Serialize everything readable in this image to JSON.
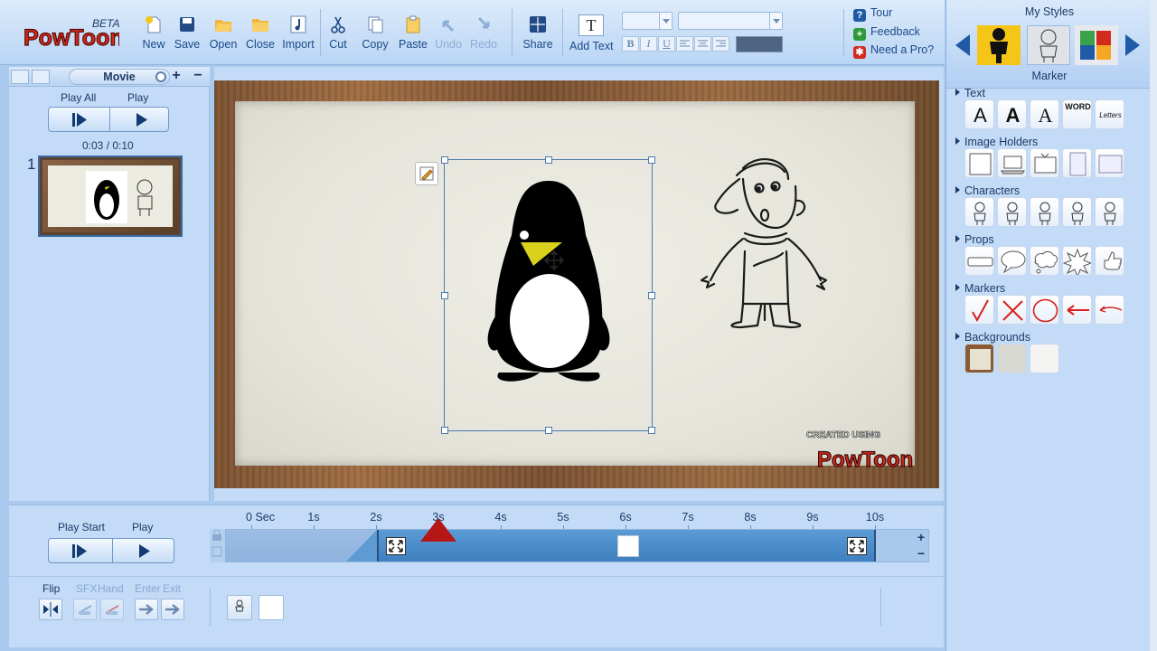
{
  "app": {
    "name": "PowToon",
    "badge": "BETA"
  },
  "toolbar": {
    "buttons": [
      {
        "label": "New",
        "icon": "new-file-icon"
      },
      {
        "label": "Save",
        "icon": "save-disk-icon"
      },
      {
        "label": "Open",
        "icon": "open-folder-icon"
      },
      {
        "label": "Close",
        "icon": "close-folder-icon"
      },
      {
        "label": "Import",
        "icon": "music-note-icon"
      },
      {
        "label": "Cut",
        "icon": "scissors-icon"
      },
      {
        "label": "Copy",
        "icon": "copy-icon"
      },
      {
        "label": "Paste",
        "icon": "paste-icon"
      },
      {
        "label": "Undo",
        "icon": "undo-arrow-icon",
        "disabled": true
      },
      {
        "label": "Redo",
        "icon": "redo-arrow-icon",
        "disabled": true
      },
      {
        "label": "Share",
        "icon": "share-grid-icon"
      },
      {
        "label": "Add Text",
        "icon": "text-T-icon"
      }
    ],
    "add_text_glyph": "T",
    "format": {
      "bold": "B",
      "italic": "I",
      "underline": "U"
    },
    "help": {
      "tour": "Tour",
      "feedback": "Feedback",
      "pro": "Need a Pro?",
      "tour_icon_text": "?",
      "feedback_icon_text": "+",
      "pro_icon_text": "✱"
    }
  },
  "left_panel": {
    "tab_label": "Movie",
    "add": "+",
    "remove": "−",
    "play_all_label": "Play All",
    "play_label": "Play",
    "time": "0:03 / 0:10",
    "slide_number": "1"
  },
  "stage": {
    "watermark_small": "CREATED USING",
    "watermark_big": "PowToon"
  },
  "right_panel": {
    "title": "My Styles",
    "selected_style": "Marker",
    "sections": {
      "text": "Text",
      "image_holders": "Image Holders",
      "characters": "Characters",
      "props": "Props",
      "markers": "Markers",
      "backgrounds": "Backgrounds"
    },
    "text_items": [
      "A",
      "A",
      "A",
      "WORD",
      "Letters"
    ]
  },
  "timeline": {
    "play_start_label": "Play Start",
    "play_label": "Play",
    "ticks": [
      "0 Sec",
      "1s",
      "2s",
      "3s",
      "4s",
      "5s",
      "6s",
      "7s",
      "8s",
      "9s",
      "10s"
    ],
    "playhead_seconds": 3,
    "object_start_seconds": 2,
    "object_end_seconds": 10,
    "zoom_in": "+",
    "zoom_out": "−",
    "flip_label": "Flip",
    "sfx_label": "SFX",
    "hand_label": "Hand",
    "enter_label": "Enter",
    "exit_label": "Exit"
  },
  "colors": {
    "accent": "#3e7fbf",
    "playhead": "#b51616",
    "selected_color": "#4f6480",
    "toolbar_bg": "#c8def7"
  }
}
